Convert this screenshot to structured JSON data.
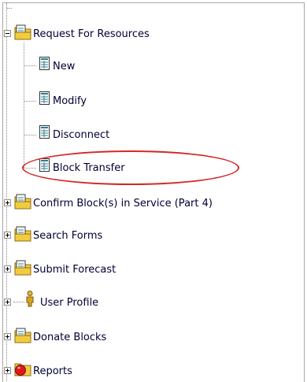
{
  "tree": {
    "root_folder": {
      "label": "Request For Resources",
      "expanded": true
    },
    "children": [
      {
        "label": "New"
      },
      {
        "label": "Modify"
      },
      {
        "label": "Disconnect"
      },
      {
        "label": "Block Transfer",
        "highlighted": true
      }
    ],
    "folders": [
      {
        "label": "Confirm Block(s) in Service (Part 4)"
      },
      {
        "label": "Search Forms"
      },
      {
        "label": "Submit Forecast"
      },
      {
        "label": "User Profile"
      },
      {
        "label": "Donate Blocks"
      },
      {
        "label": "Reports"
      }
    ]
  },
  "colors": {
    "highlight_ring": "#d42828",
    "folder": "#f2cc3f",
    "reports_icon": "#e01818"
  }
}
